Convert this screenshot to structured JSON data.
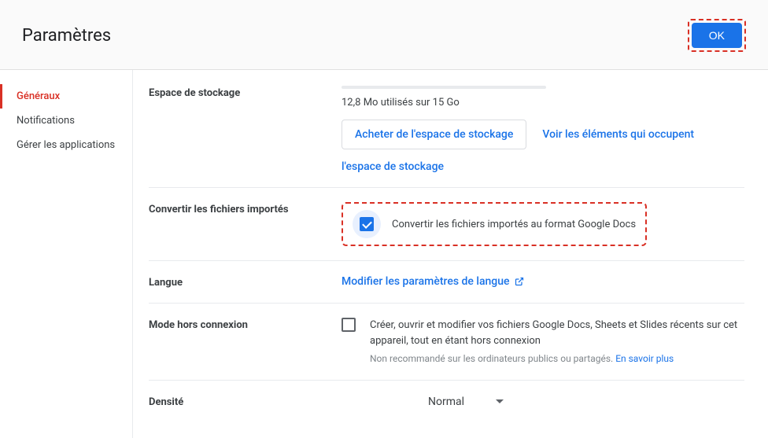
{
  "header": {
    "title": "Paramètres",
    "ok": "OK"
  },
  "sidebar": {
    "items": [
      {
        "label": "Généraux"
      },
      {
        "label": "Notifications"
      },
      {
        "label": "Gérer les applications"
      }
    ]
  },
  "storage": {
    "heading": "Espace de stockage",
    "usage": "12,8 Mo utilisés sur 15 Go",
    "buy": "Acheter de l'espace de stockage",
    "view1": "Voir les éléments qui occupent",
    "view2": "l'espace de stockage"
  },
  "convert": {
    "heading": "Convertir les fichiers importés",
    "label": "Convertir les fichiers importés au format Google Docs"
  },
  "language": {
    "heading": "Langue",
    "link": "Modifier les paramètres de langue"
  },
  "offline": {
    "heading": "Mode hors connexion",
    "text": "Créer, ouvrir et modifier vos fichiers Google Docs, Sheets et Slides récents sur cet appareil, tout en étant hors connexion",
    "sub": "Non recommandé sur les ordinateurs publics ou partagés.",
    "learn": "En savoir plus"
  },
  "density": {
    "heading": "Densité",
    "value": "Normal"
  }
}
